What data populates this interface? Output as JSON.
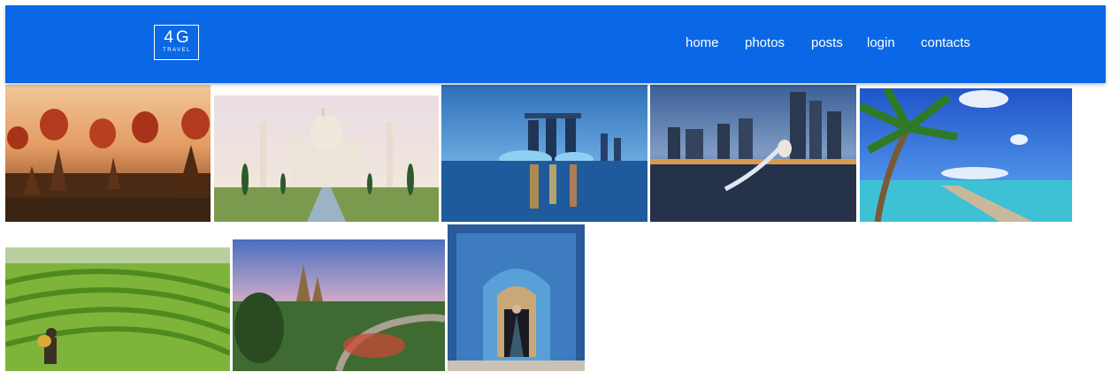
{
  "brand": {
    "logo_text": "4G",
    "logo_subtext": "TRAVEL"
  },
  "nav": {
    "items": [
      "home",
      "photos",
      "posts",
      "login",
      "contacts"
    ]
  },
  "gallery": {
    "photos": [
      {
        "name": "photo-hot-air-balloons-temples"
      },
      {
        "name": "photo-taj-mahal"
      },
      {
        "name": "photo-marina-bay-sands"
      },
      {
        "name": "photo-merlion-skyline"
      },
      {
        "name": "photo-palm-beach-pier"
      },
      {
        "name": "photo-rice-terraces"
      },
      {
        "name": "photo-pagoda-gardens"
      },
      {
        "name": "photo-blue-mosaic-doorway"
      }
    ]
  },
  "colors": {
    "header": "#0a68e6",
    "nav_text": "#ffffff",
    "background": "#ffffff"
  }
}
